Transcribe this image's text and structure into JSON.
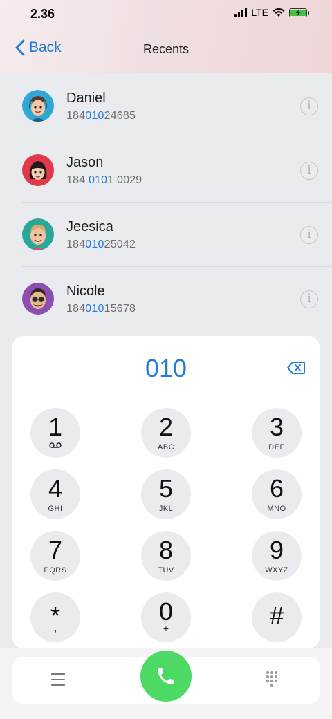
{
  "status_bar": {
    "time": "2.36",
    "network": "LTE"
  },
  "nav": {
    "back_label": "Back",
    "title": "Recents"
  },
  "recents": [
    {
      "name": "Daniel",
      "number_pre": "184",
      "number_hl": "010",
      "number_post": "24685",
      "avatar_color": "#2fa8d6"
    },
    {
      "name": "Jason",
      "number_pre": "184 ",
      "number_hl": "010",
      "number_post": "1 0029",
      "avatar_color": "#e2384a"
    },
    {
      "name": "Jeesica",
      "number_pre": "184",
      "number_hl": "010",
      "number_post": "25042",
      "avatar_color": "#2aa79b"
    },
    {
      "name": "Nicole",
      "number_pre": "184",
      "number_hl": "010",
      "number_post": "15678",
      "avatar_color": "#8a4fb0"
    }
  ],
  "dialpad": {
    "display": "010",
    "keys": [
      {
        "digit": "1",
        "letters": ""
      },
      {
        "digit": "2",
        "letters": "ABC"
      },
      {
        "digit": "3",
        "letters": "DEF"
      },
      {
        "digit": "4",
        "letters": "GHI"
      },
      {
        "digit": "5",
        "letters": "JKL"
      },
      {
        "digit": "6",
        "letters": "MNO"
      },
      {
        "digit": "7",
        "letters": "PQRS"
      },
      {
        "digit": "8",
        "letters": "TUV"
      },
      {
        "digit": "9",
        "letters": "WXYZ"
      },
      {
        "digit": "*",
        "sub": ","
      },
      {
        "digit": "0",
        "sub": "+"
      },
      {
        "digit": "#",
        "letters": ""
      }
    ]
  },
  "icons": {
    "back": "chevron-left-icon",
    "info": "info-icon",
    "backspace": "backspace-icon",
    "voicemail": "voicemail-icon",
    "menu": "menu-icon",
    "call": "phone-icon",
    "keypad": "keypad-icon"
  },
  "colors": {
    "accent": "#1e7be0",
    "call": "#4cd964"
  }
}
